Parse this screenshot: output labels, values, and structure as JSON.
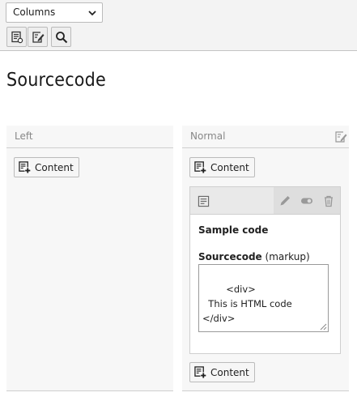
{
  "toolbar": {
    "select_value": "Columns",
    "buttons": [
      "view-page-icon",
      "edit-page-icon",
      "search-icon"
    ]
  },
  "page": {
    "title": "Sourcecode"
  },
  "columns": {
    "left": {
      "label": "Left",
      "add_label": "Content"
    },
    "normal": {
      "label": "Normal",
      "add_label": "Content",
      "add_label_bottom": "Content",
      "element": {
        "title": "Sample code",
        "field_label": "Sourcecode",
        "field_hint": "(markup)",
        "code": "<div>\n  This is HTML code\n</div>"
      }
    }
  },
  "colors": {
    "toolbar_bg": "#f3f3f3",
    "column_bg": "#f7f7f7",
    "card_header_bg": "#e9e9e9"
  }
}
